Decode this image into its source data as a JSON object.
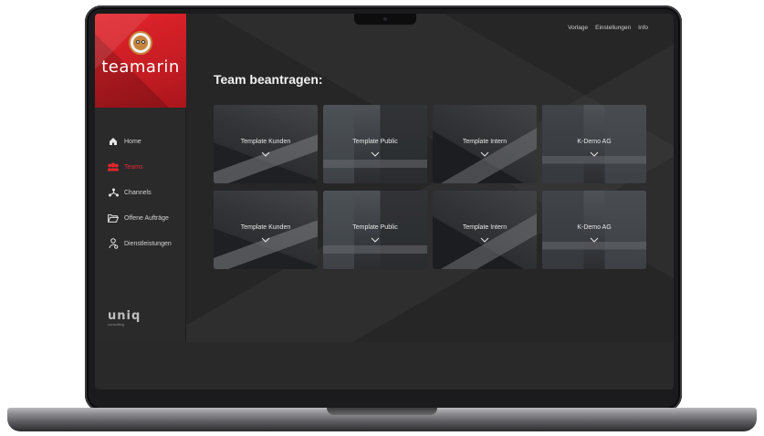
{
  "brand": {
    "name": "teamarin",
    "accent": "#e1262d"
  },
  "topnav": {
    "items": [
      "Vorlage",
      "Einstellungen",
      "Info"
    ]
  },
  "sidebar": {
    "items": [
      {
        "label": "Home",
        "icon": "home-icon",
        "active": false
      },
      {
        "label": "Teams",
        "icon": "users-icon",
        "active": true
      },
      {
        "label": "Channels",
        "icon": "network-icon",
        "active": false
      },
      {
        "label": "Offene Aufträge",
        "icon": "folder-icon",
        "active": false
      },
      {
        "label": "Dienstleistungen",
        "icon": "person-gear-icon",
        "active": false
      }
    ],
    "footer": {
      "logo": "uniq",
      "tagline": "consulting"
    }
  },
  "main": {
    "title": "Team beantragen:",
    "tiles": [
      {
        "label": "Template Kunden"
      },
      {
        "label": "Template Public"
      },
      {
        "label": "Template Intern"
      },
      {
        "label": "K-Demo AG"
      },
      {
        "label": "Template Kunden"
      },
      {
        "label": "Template Public"
      },
      {
        "label": "Template Intern"
      },
      {
        "label": "K-Demo AG"
      }
    ]
  }
}
